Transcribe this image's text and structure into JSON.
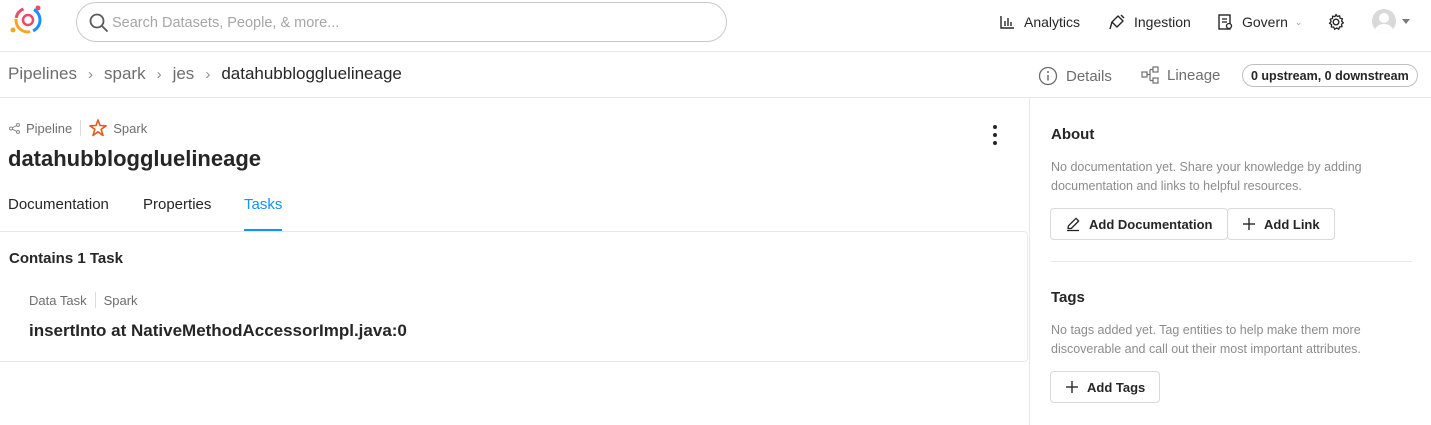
{
  "header": {
    "search_placeholder": "Search Datasets, People, & more...",
    "nav": {
      "analytics": "Analytics",
      "ingestion": "Ingestion",
      "govern": "Govern"
    }
  },
  "breadcrumb": {
    "items": [
      "Pipelines",
      "spark",
      "jes"
    ],
    "current": "datahubbloggluelineage",
    "separator": "›"
  },
  "view_tabs": {
    "details": "Details",
    "lineage": "Lineage",
    "lineage_count": "0 upstream, 0 downstream"
  },
  "entity": {
    "type": "Pipeline",
    "platform": "Spark",
    "name": "datahubbloggluelineage"
  },
  "tabs": {
    "documentation": "Documentation",
    "properties": "Properties",
    "tasks": "Tasks",
    "active": "Tasks"
  },
  "tasks_panel": {
    "heading": "Contains 1 Task",
    "tasks": [
      {
        "type": "Data Task",
        "platform": "Spark",
        "name": "insertInto at NativeMethodAccessorImpl.java:0"
      }
    ]
  },
  "sidebar": {
    "about": {
      "title": "About",
      "text": "No documentation yet. Share your knowledge by adding documentation and links to helpful resources.",
      "add_documentation": "Add Documentation",
      "add_link": "Add Link"
    },
    "tags": {
      "title": "Tags",
      "text": "No tags added yet. Tag entities to help make them more discoverable and call out their most important attributes.",
      "add_tags": "Add Tags"
    }
  },
  "colors": {
    "accent": "#1890ff",
    "spark": "#e25a1c",
    "text": "#262626",
    "muted": "#8c8c8c"
  },
  "icons": [
    "logo-icon",
    "search-icon",
    "analytics-icon",
    "ingestion-icon",
    "govern-icon",
    "chevron-down-icon",
    "gear-icon",
    "avatar",
    "info-icon",
    "lineage-icon",
    "pipeline-icon",
    "spark-icon",
    "more-vertical-icon",
    "edit-icon",
    "plus-icon"
  ]
}
